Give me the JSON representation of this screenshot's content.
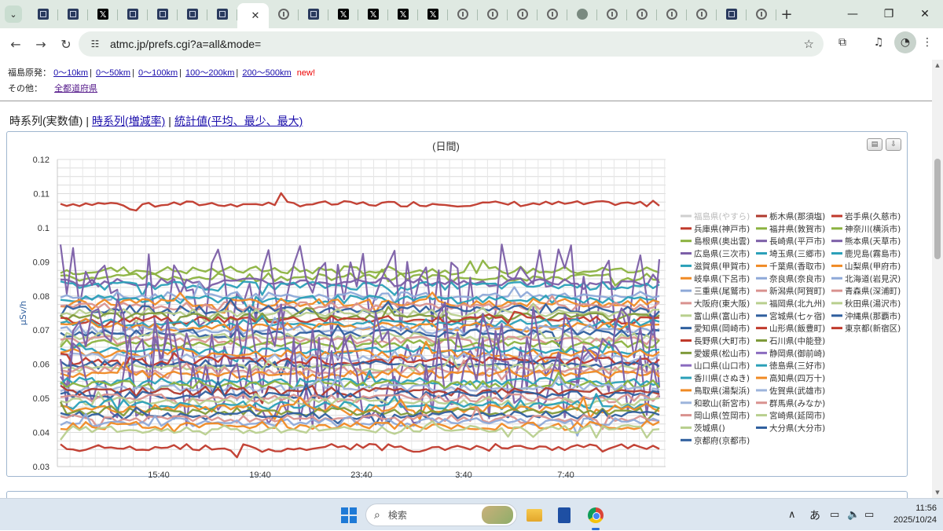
{
  "browser": {
    "url": "atmc.jp/prefs.cgi?a=all&mode=",
    "tabs": [
      {
        "icon": "atmc-icon",
        "active": false
      },
      {
        "icon": "atmc-icon",
        "active": false
      },
      {
        "icon": "x-icon",
        "active": false
      },
      {
        "icon": "atmc-icon",
        "active": false
      },
      {
        "icon": "atmc-icon",
        "active": false
      },
      {
        "icon": "atmc-icon",
        "active": false
      },
      {
        "icon": "atmc-icon",
        "active": false
      },
      {
        "icon": "atmc-icon",
        "active": true
      },
      {
        "icon": "circle-icon",
        "active": false
      },
      {
        "icon": "atmc-icon",
        "active": false
      },
      {
        "icon": "x-icon",
        "active": false
      },
      {
        "icon": "x-icon",
        "active": false
      },
      {
        "icon": "x-icon",
        "active": false
      },
      {
        "icon": "x-icon",
        "active": false
      },
      {
        "icon": "circle-icon",
        "active": false
      },
      {
        "icon": "circle-icon",
        "active": false
      },
      {
        "icon": "circle-icon",
        "active": false
      },
      {
        "icon": "circle-icon",
        "active": false
      },
      {
        "icon": "globe-icon",
        "active": false
      },
      {
        "icon": "circle-icon",
        "active": false
      },
      {
        "icon": "circle-icon",
        "active": false
      },
      {
        "icon": "circle-icon",
        "active": false
      },
      {
        "icon": "circle-icon",
        "active": false
      },
      {
        "icon": "atmc-icon",
        "active": false
      },
      {
        "icon": "circle-icon",
        "active": false
      }
    ]
  },
  "nav": {
    "fukushima_label": "福島原発：",
    "distance_links": [
      "0～10km",
      "0～50km",
      "0～100km",
      "100～200km",
      "200～500km"
    ],
    "new_badge": "new!",
    "other_label": "その他：",
    "all_prefs_link": "全都道府県"
  },
  "view_tabs": {
    "current": "時系列(実数値)",
    "growth": "時系列(増減率)",
    "stats": "統計値(平均、最少、最大)",
    "sep": "|"
  },
  "taskbar": {
    "search_placeholder": "検索",
    "ime": "あ",
    "time": "11:56",
    "date": "2025/10/24"
  },
  "chart_data": {
    "type": "line",
    "title": "(日間)",
    "ylabel": "μSv/h",
    "ylim": [
      0.03,
      0.12
    ],
    "yticks": [
      "0.12",
      "0.11",
      "0.1",
      "0.09",
      "0.08",
      "0.07",
      "0.06",
      "0.05",
      "0.04",
      "0.03"
    ],
    "xticks": [
      "15:40",
      "19:40",
      "23:40",
      "3:40",
      "7:40"
    ],
    "grid": true,
    "legend_position": "right",
    "legend": [
      {
        "name": "福島県(やすら)",
        "color": "#c8c8c8",
        "hidden": true
      },
      {
        "name": "兵庫県(神戸市)",
        "color": "#c0392b"
      },
      {
        "name": "島根県(奥出雲)",
        "color": "#8bb23f"
      },
      {
        "name": "広島県(三次市)",
        "color": "#7b5ea7"
      },
      {
        "name": "滋賀県(甲賀市)",
        "color": "#2aa0b8"
      },
      {
        "name": "岐阜県(下呂市)",
        "color": "#f08a24"
      },
      {
        "name": "三重県(尾鷲市)",
        "color": "#8ea9d8"
      },
      {
        "name": "大阪府(東大阪)",
        "color": "#d9928f"
      },
      {
        "name": "富山県(富山市)",
        "color": "#b8cf8e"
      },
      {
        "name": "愛知県(岡崎市)",
        "color": "#2f5f9e"
      },
      {
        "name": "長野県(大町市)",
        "color": "#c0392b"
      },
      {
        "name": "愛媛県(松山市)",
        "color": "#7f9a3a"
      },
      {
        "name": "山口県(山口市)",
        "color": "#8a6bbf"
      },
      {
        "name": "香川県(さぬき)",
        "color": "#2aa0b8"
      },
      {
        "name": "鳥取県(湯梨浜)",
        "color": "#f08a24"
      },
      {
        "name": "和歌山(新宮市)",
        "color": "#9db4dc"
      },
      {
        "name": "岡山県(笠岡市)",
        "color": "#d9928f"
      },
      {
        "name": "茨城県()",
        "color": "#b8cf8e"
      },
      {
        "name": "京都府(京都市)",
        "color": "#2f5f9e"
      },
      {
        "name": "栃木県(那須塩)",
        "color": "#b03a2e"
      },
      {
        "name": "福井県(敦賀市)",
        "color": "#8bb23f"
      },
      {
        "name": "長崎県(平戸市)",
        "color": "#7b5ea7"
      },
      {
        "name": "埼玉県(三郷市)",
        "color": "#2aa0b8"
      },
      {
        "name": "千葉県(香取市)",
        "color": "#f08a24"
      },
      {
        "name": "奈良県(奈良市)",
        "color": "#8ea9d8"
      },
      {
        "name": "新潟県(阿賀町)",
        "color": "#d9928f"
      },
      {
        "name": "福岡県(北九州)",
        "color": "#b8cf8e"
      },
      {
        "name": "宮城県(七ヶ宿)",
        "color": "#2f5f9e"
      },
      {
        "name": "山形県(飯豊町)",
        "color": "#c0392b"
      },
      {
        "name": "石川県(中能登)",
        "color": "#7f9a3a"
      },
      {
        "name": "静岡県(御前崎)",
        "color": "#8a6bbf"
      },
      {
        "name": "徳島県(三好市)",
        "color": "#2aa0b8"
      },
      {
        "name": "高知県(四万十)",
        "color": "#f08a24"
      },
      {
        "name": "佐賀県(武雄市)",
        "color": "#9db4dc"
      },
      {
        "name": "群馬県(みなか)",
        "color": "#d9928f"
      },
      {
        "name": "宮崎県(延岡市)",
        "color": "#b8cf8e"
      },
      {
        "name": "大分県(大分市)",
        "color": "#2f5f9e"
      },
      {
        "name": "岩手県(久慈市)",
        "color": "#c0392b"
      },
      {
        "name": "神奈川(横浜市)",
        "color": "#8bb23f"
      },
      {
        "name": "熊本県(天草市)",
        "color": "#7b5ea7"
      },
      {
        "name": "鹿児島(霧島市)",
        "color": "#2aa0b8"
      },
      {
        "name": "山梨県(甲府市)",
        "color": "#f08a24"
      },
      {
        "name": "北海道(岩見沢)",
        "color": "#8ea9d8"
      },
      {
        "name": "青森県(深浦町)",
        "color": "#d9928f"
      },
      {
        "name": "秋田県(湯沢市)",
        "color": "#b8cf8e"
      },
      {
        "name": "沖縄県(那覇市)",
        "color": "#2f5f9e"
      },
      {
        "name": "東京都(新宿区)",
        "color": "#c0392b"
      }
    ],
    "series_levels": [
      0.107,
      0.0875,
      0.0855,
      0.084,
      0.083,
      0.0815,
      0.08,
      0.079,
      0.078,
      0.077,
      0.076,
      0.075,
      0.074,
      0.073,
      0.072,
      0.071,
      0.07,
      0.069,
      0.068,
      0.067,
      0.066,
      0.065,
      0.064,
      0.063,
      0.062,
      0.061,
      0.06,
      0.059,
      0.058,
      0.057,
      0.056,
      0.055,
      0.054,
      0.053,
      0.052,
      0.051,
      0.05,
      0.049,
      0.048,
      0.047,
      0.046,
      0.045,
      0.044,
      0.043,
      0.042,
      0.041,
      0.0355
    ],
    "series_colors": [
      "#c0392b",
      "#8bb23f",
      "#8bb23f",
      "#7b5ea7",
      "#2aa0b8",
      "#7b5ea7",
      "#8ea9d8",
      "#2aa0b8",
      "#f08a24",
      "#d9928f",
      "#2f5f9e",
      "#b8cf8e",
      "#7f9a3a",
      "#c0392b",
      "#2aa0b8",
      "#f08a24",
      "#8ea9d8",
      "#2f5f9e",
      "#b8cf8e",
      "#d9928f",
      "#8bb23f",
      "#7b5ea7",
      "#2aa0b8",
      "#f08a24",
      "#9db4dc",
      "#c0392b",
      "#2f5f9e",
      "#b8cf8e",
      "#d9928f",
      "#f08a24",
      "#7b5ea7",
      "#2aa0b8",
      "#8bb23f",
      "#9db4dc",
      "#b03a2e",
      "#2f5f9e",
      "#d9928f",
      "#b8cf8e",
      "#2aa0b8",
      "#f08a24",
      "#7f9a3a",
      "#2f5f9e",
      "#d9928f",
      "#8ea9d8",
      "#f08a24",
      "#b8cf8e",
      "#c0392b"
    ]
  }
}
